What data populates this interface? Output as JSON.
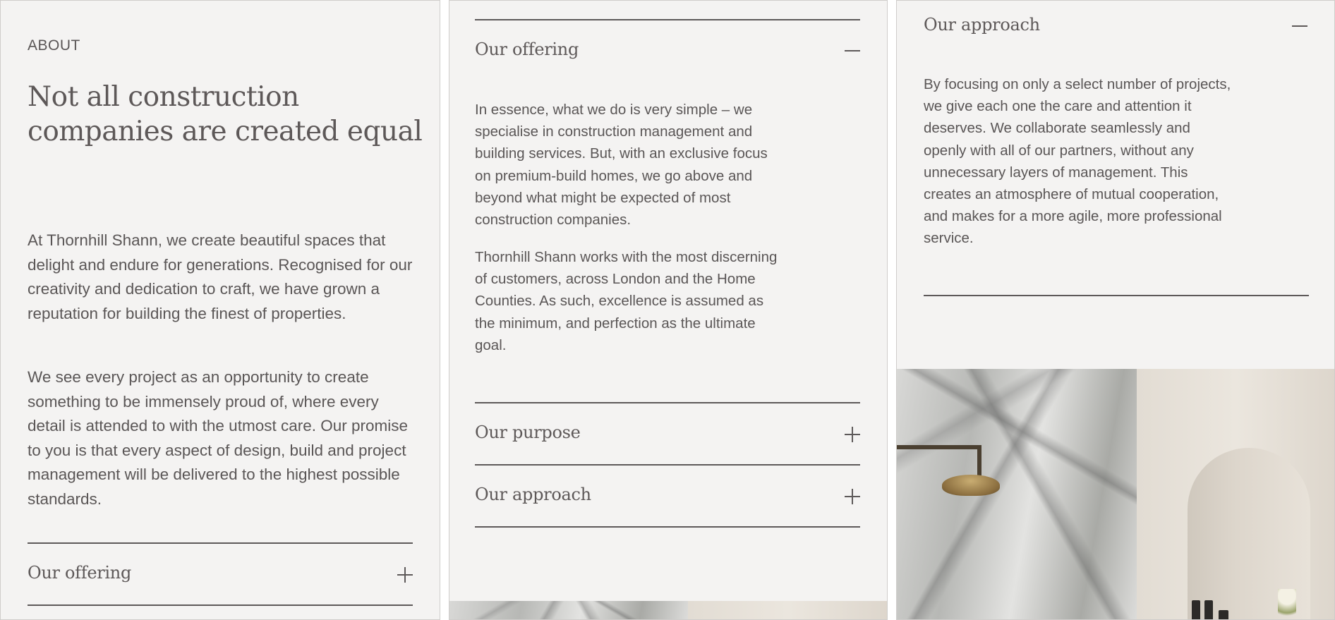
{
  "about": {
    "eyebrow": "ABOUT",
    "heading": "Not all construction companies are created equal",
    "para1": "At Thornhill Shann, we create beautiful spaces that delight and endure for generations. Recognised for our creativity and dedication to craft, we have grown a reputation for building the finest of properties.",
    "para2": "We see every project as an opportunity to create something to be immensely proud of, where every detail is attended to with the utmost care. Our promise to you is that every aspect of design, build and project management will be delivered to the highest possible standards.",
    "accordion_offering_title": "Our offering"
  },
  "offering_panel": {
    "offering_title": "Our offering",
    "offering_para1": "In essence, what we do is very simple – we specialise in construction management and building services. But, with an exclusive focus on premium-build homes, we go above and beyond what might be expected of most construction companies.",
    "offering_para2": "Thornhill Shann works with the most discerning of customers, across London and the Home Counties. As such, excellence is assumed as the minimum, and perfection as the ultimate goal.",
    "purpose_title": "Our purpose",
    "approach_title": "Our approach"
  },
  "approach_panel": {
    "approach_title": "Our approach",
    "approach_para": "By focusing on only a select number of projects, we give each one the care and attention it deserves. We collaborate seamlessly and openly with all of our partners, without any unnecessary layers of management. This creates an atmosphere of mutual cooperation, and makes for a more agile, more professional service."
  },
  "icons": {
    "expand": "plus-icon",
    "collapse": "minus-icon"
  },
  "colors": {
    "panel_bg": "#f4f3f2",
    "text": "#5a5656",
    "rule": "#5d5959"
  }
}
